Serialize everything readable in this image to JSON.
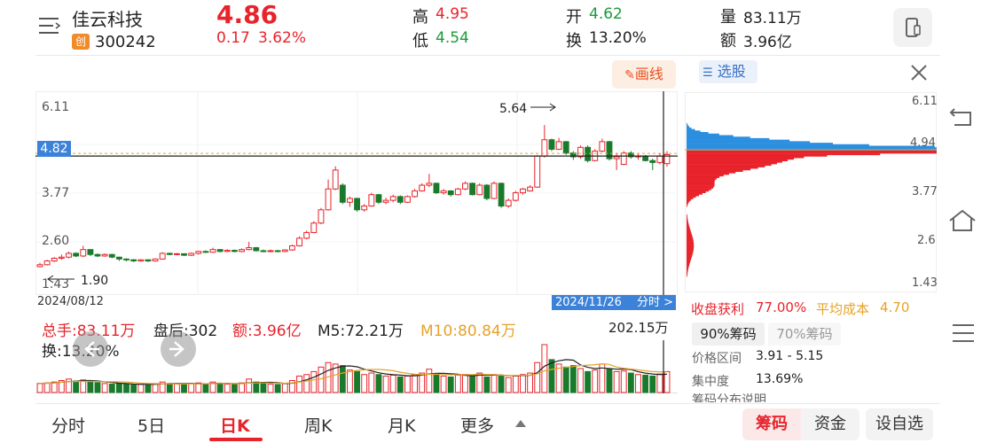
{
  "header": {
    "menu_icon": "menu-icon",
    "stock_name": "佳云科技",
    "board_badge": "创",
    "stock_code": "300242",
    "price": "4.86",
    "change": "0.17",
    "change_pct": "3.62%",
    "high_label": "高",
    "high_value": "4.95",
    "low_label": "低",
    "low_value": "4.54",
    "open_label": "开",
    "open_value": "4.62",
    "turnover_label": "换",
    "turnover_value": "13.20%",
    "volume_label": "量",
    "volume_value": "83.11万",
    "amount_label": "额",
    "amount_value": "3.96亿",
    "phone_icon": "phone-screen-icon"
  },
  "chart": {
    "draw_button": "画线",
    "y_labels": [
      "6.11",
      "3.77",
      "2.60",
      "1.43"
    ],
    "current_price_tag": "4.82",
    "high_annotation": "5.64",
    "low_annotation": "1.90",
    "start_date": "2024/08/12",
    "cursor_date": "2024/11/26",
    "intraday_link": "分时 >"
  },
  "volume": {
    "total_hands": "总手:83.11万",
    "after_hours": "盘后:302",
    "amount": "额:3.96亿",
    "m5": "M5:72.21万",
    "m10": "M10:80.84万",
    "turnover": "换:13.20%",
    "max_label": "202.15万"
  },
  "right_panel": {
    "select_stock": "选股",
    "y_labels": [
      "6.11",
      "4.94",
      "3.77",
      "2.6",
      "1.43"
    ],
    "profit_label": "收盘获利",
    "profit_value": "77.00%",
    "avg_cost_label": "平均成本",
    "avg_cost_value": "4.70",
    "tab_90": "90%筹码",
    "tab_70": "70%筹码",
    "range_label": "价格区间",
    "range_value": "3.91 - 5.15",
    "concentration_label": "集中度",
    "concentration_value": "13.69%",
    "dist_note": "筹码分布说明"
  },
  "bottom_tabs": [
    "分时",
    "5日",
    "日K",
    "周K",
    "月K",
    "更多"
  ],
  "bottom_buttons": {
    "chips": "筹码",
    "funds": "资金",
    "set_watch": "设自选"
  },
  "candles": [
    [
      1.9,
      1.95,
      2.0,
      1.88
    ],
    [
      1.95,
      2.05,
      2.08,
      1.93
    ],
    [
      2.05,
      2.12,
      2.15,
      2.02
    ],
    [
      2.12,
      2.15,
      2.22,
      2.08
    ],
    [
      2.15,
      2.25,
      2.3,
      2.12
    ],
    [
      2.25,
      2.18,
      2.28,
      2.15
    ],
    [
      2.18,
      2.35,
      2.45,
      2.15
    ],
    [
      2.35,
      2.22,
      2.36,
      2.18
    ],
    [
      2.22,
      2.18,
      2.25,
      2.15
    ],
    [
      2.18,
      2.22,
      2.25,
      2.16
    ],
    [
      2.22,
      2.15,
      2.24,
      2.12
    ],
    [
      2.15,
      2.1,
      2.16,
      2.05
    ],
    [
      2.1,
      2.08,
      2.12,
      2.04
    ],
    [
      2.08,
      2.05,
      2.1,
      2.02
    ],
    [
      2.05,
      2.08,
      2.1,
      2.03
    ],
    [
      2.08,
      2.05,
      2.09,
      2.02
    ],
    [
      2.05,
      2.1,
      2.12,
      2.03
    ],
    [
      2.1,
      2.25,
      2.28,
      2.08
    ],
    [
      2.25,
      2.22,
      2.27,
      2.2
    ],
    [
      2.22,
      2.24,
      2.26,
      2.2
    ],
    [
      2.24,
      2.2,
      2.25,
      2.18
    ],
    [
      2.2,
      2.25,
      2.27,
      2.18
    ],
    [
      2.25,
      2.3,
      2.32,
      2.22
    ],
    [
      2.3,
      2.28,
      2.33,
      2.26
    ],
    [
      2.28,
      2.35,
      2.4,
      2.26
    ],
    [
      2.35,
      2.3,
      2.36,
      2.28
    ],
    [
      2.3,
      2.33,
      2.36,
      2.28
    ],
    [
      2.33,
      2.3,
      2.35,
      2.28
    ],
    [
      2.3,
      2.35,
      2.38,
      2.28
    ],
    [
      2.35,
      2.4,
      2.55,
      2.33
    ],
    [
      2.4,
      2.32,
      2.42,
      2.3
    ],
    [
      2.32,
      2.3,
      2.35,
      2.28
    ],
    [
      2.3,
      2.32,
      2.35,
      2.28
    ],
    [
      2.32,
      2.3,
      2.34,
      2.28
    ],
    [
      2.3,
      2.34,
      2.36,
      2.28
    ],
    [
      2.34,
      2.45,
      2.48,
      2.32
    ],
    [
      2.45,
      2.65,
      2.7,
      2.43
    ],
    [
      2.65,
      2.8,
      2.85,
      2.62
    ],
    [
      2.8,
      3.05,
      3.1,
      2.78
    ],
    [
      3.05,
      3.4,
      3.45,
      3.02
    ],
    [
      3.4,
      3.95,
      4.2,
      3.38
    ],
    [
      3.95,
      4.45,
      4.55,
      3.92
    ],
    [
      4.05,
      3.6,
      4.1,
      3.55
    ],
    [
      3.6,
      3.7,
      3.75,
      3.48
    ],
    [
      3.7,
      3.4,
      3.72,
      3.35
    ],
    [
      3.4,
      3.5,
      3.55,
      3.35
    ],
    [
      3.5,
      3.8,
      3.85,
      3.48
    ],
    [
      3.8,
      3.6,
      3.82,
      3.55
    ],
    [
      3.6,
      3.65,
      3.72,
      3.55
    ],
    [
      3.65,
      3.75,
      3.8,
      3.6
    ],
    [
      3.75,
      3.6,
      3.78,
      3.55
    ],
    [
      3.6,
      3.75,
      3.78,
      3.58
    ],
    [
      3.75,
      3.9,
      3.95,
      3.72
    ],
    [
      3.9,
      4.05,
      4.1,
      3.88
    ],
    [
      4.05,
      4.1,
      4.35,
      4.0
    ],
    [
      4.1,
      3.85,
      4.12,
      3.82
    ],
    [
      3.85,
      3.9,
      3.95,
      3.8
    ],
    [
      3.9,
      3.8,
      3.92,
      3.75
    ],
    [
      3.8,
      3.95,
      3.98,
      3.78
    ],
    [
      3.95,
      4.1,
      4.15,
      3.92
    ],
    [
      4.1,
      3.8,
      4.12,
      3.78
    ],
    [
      3.8,
      4.05,
      4.1,
      3.78
    ],
    [
      4.05,
      3.7,
      4.08,
      3.65
    ],
    [
      3.7,
      4.1,
      4.15,
      3.68
    ],
    [
      4.1,
      3.5,
      4.12,
      3.45
    ],
    [
      3.5,
      3.65,
      3.7,
      3.45
    ],
    [
      3.65,
      3.85,
      3.9,
      3.62
    ],
    [
      3.85,
      3.95,
      3.98,
      3.8
    ],
    [
      3.9,
      4.0,
      4.05,
      3.88
    ],
    [
      4.0,
      4.82,
      4.85,
      3.98
    ],
    [
      4.82,
      5.25,
      5.64,
      4.78
    ],
    [
      5.25,
      5.0,
      5.28,
      4.95
    ],
    [
      5.0,
      5.2,
      5.3,
      4.98
    ],
    [
      5.2,
      4.9,
      5.22,
      4.85
    ],
    [
      4.9,
      4.8,
      4.95,
      4.72
    ],
    [
      4.8,
      5.05,
      5.1,
      4.75
    ],
    [
      5.05,
      4.7,
      5.1,
      4.65
    ],
    [
      4.7,
      4.95,
      5.0,
      4.68
    ],
    [
      4.95,
      5.2,
      5.28,
      4.92
    ],
    [
      5.2,
      4.75,
      5.22,
      4.7
    ],
    [
      4.75,
      4.8,
      4.9,
      4.45
    ],
    [
      4.6,
      4.9,
      4.95,
      4.58
    ],
    [
      4.9,
      4.8,
      4.95,
      4.75
    ],
    [
      4.8,
      4.82,
      4.88,
      4.72
    ],
    [
      4.82,
      4.7,
      4.85,
      4.68
    ],
    [
      4.7,
      4.65,
      4.75,
      4.45
    ],
    [
      4.65,
      4.82,
      4.9,
      4.6
    ],
    [
      4.62,
      4.86,
      4.95,
      4.54
    ]
  ],
  "volumes": [
    0.3,
    0.32,
    0.35,
    0.4,
    0.45,
    0.38,
    0.42,
    0.35,
    0.33,
    0.3,
    0.28,
    0.3,
    0.28,
    0.25,
    0.27,
    0.26,
    0.3,
    0.35,
    0.3,
    0.28,
    0.27,
    0.3,
    0.32,
    0.28,
    0.35,
    0.3,
    0.28,
    0.27,
    0.32,
    0.45,
    0.35,
    0.3,
    0.28,
    0.27,
    0.3,
    0.4,
    0.55,
    0.6,
    0.7,
    0.85,
    1.0,
    0.95,
    0.9,
    0.75,
    0.7,
    0.6,
    0.65,
    0.6,
    0.55,
    0.58,
    0.52,
    0.55,
    0.6,
    0.65,
    0.78,
    0.62,
    0.55,
    0.52,
    0.58,
    0.6,
    0.55,
    0.65,
    0.52,
    0.6,
    0.58,
    0.5,
    0.55,
    0.6,
    0.65,
    1.0,
    1.6,
    1.1,
    0.95,
    0.85,
    0.9,
    0.8,
    0.7,
    0.75,
    0.95,
    0.8,
    0.7,
    0.72,
    0.65,
    0.6,
    0.58,
    0.55,
    0.62,
    0.7
  ],
  "colors": {
    "up": "#e8232b",
    "down": "#1a7a2c",
    "accent_blue": "#3b82d8",
    "m5_line": "#222222",
    "m10_line": "#e6a22a"
  }
}
